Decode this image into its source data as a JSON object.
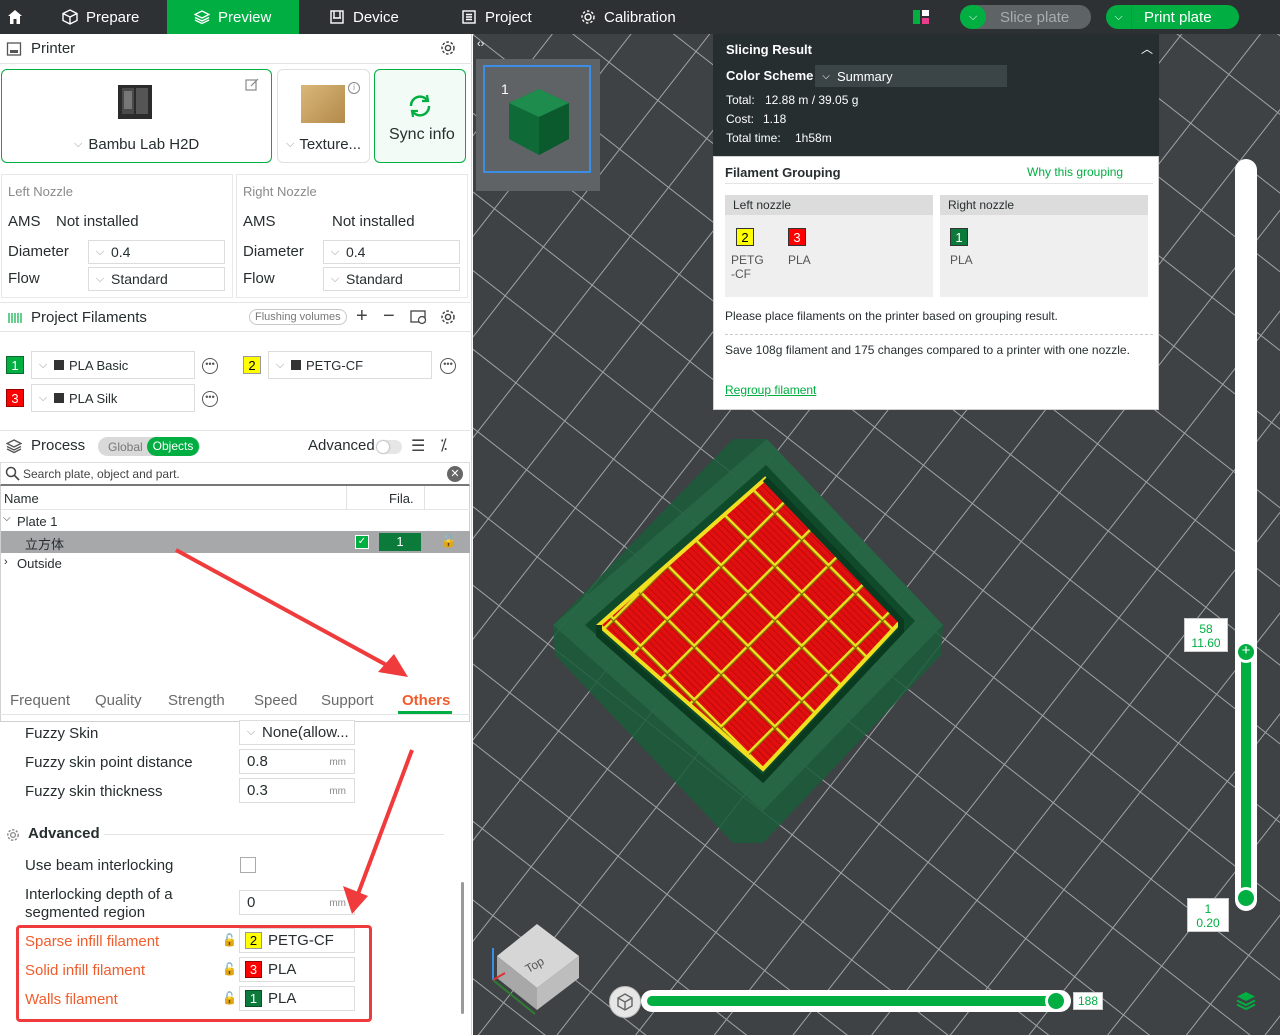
{
  "topbar": {
    "tabs": [
      {
        "label": "Prepare",
        "icon": "cube-icon"
      },
      {
        "label": "Preview",
        "icon": "layers-icon"
      },
      {
        "label": "Device",
        "icon": "printer-icon"
      },
      {
        "label": "Project",
        "icon": "project-icon"
      },
      {
        "label": "Calibration",
        "icon": "gear-icon"
      }
    ],
    "slice_label": "Slice plate",
    "print_label": "Print plate",
    "accent": "#00ae42",
    "bar_color": "#2e3133"
  },
  "printer": {
    "title": "Printer",
    "model": "Bambu Lab H2D",
    "plate": "Texture...",
    "sync_label": "Sync info",
    "left_nozzle": {
      "title": "Left Nozzle",
      "ams_label": "AMS",
      "ams_value": "Not installed",
      "diameter_label": "Diameter",
      "diameter": "0.4",
      "flow_label": "Flow",
      "flow": "Standard"
    },
    "right_nozzle": {
      "title": "Right Nozzle",
      "ams_label": "AMS",
      "ams_value": "Not installed",
      "diameter_label": "Diameter",
      "diameter": "0.4",
      "flow_label": "Flow",
      "flow": "Standard"
    }
  },
  "filaments": {
    "title": "Project Filaments",
    "flushing_label": "Flushing volumes",
    "items": [
      {
        "num": "1",
        "name": "PLA Basic",
        "color": "#00ae42"
      },
      {
        "num": "2",
        "name": "PETG-CF",
        "color": "#ffff00"
      },
      {
        "num": "3",
        "name": "PLA Silk",
        "color": "#ff0000"
      }
    ]
  },
  "process": {
    "title": "Process",
    "toggle_global": "Global",
    "toggle_objects": "Objects",
    "advanced_label": "Advanced",
    "search_placeholder": "Search plate, object and part.",
    "col_name": "Name",
    "col_fila": "Fila.",
    "tree": {
      "plate": "Plate 1",
      "object": "立方体",
      "object_fila": "1",
      "outside": "Outside"
    }
  },
  "settings": {
    "tabs": [
      "Frequent",
      "Quality",
      "Strength",
      "Speed",
      "Support",
      "Others"
    ],
    "active_tab": "Others",
    "fuzzy_skin_label": "Fuzzy Skin",
    "fuzzy_skin_value": "None(allow...",
    "fuzzy_point_label": "Fuzzy skin point distance",
    "fuzzy_point_value": "0.8",
    "fuzzy_thick_label": "Fuzzy skin thickness",
    "fuzzy_thick_value": "0.3",
    "unit_mm": "mm",
    "advanced_title": "Advanced",
    "beam_label": "Use beam interlocking",
    "depth_label": "Interlocking depth of a segmented region",
    "depth_value": "0",
    "sparse_label": "Sparse infill filament",
    "sparse_num": "2",
    "sparse_value": "PETG-CF",
    "solid_label": "Solid infill filament",
    "solid_num": "3",
    "solid_value": "PLA",
    "walls_label": "Walls filament",
    "walls_num": "1",
    "walls_value": "PLA"
  },
  "slicing": {
    "title": "Slicing Result",
    "scheme_label": "Color Scheme",
    "scheme_value": "Summary",
    "total_label": "Total:",
    "total_value": "12.88 m / 39.05 g",
    "cost_label": "Cost:",
    "cost_value": "1.18",
    "time_label": "Total time:",
    "time_value": "1h58m",
    "grouping_title": "Filament Grouping",
    "why_label": "Why this grouping",
    "left_nozzle_label": "Left nozzle",
    "right_nozzle_label": "Right nozzle",
    "left_items": [
      {
        "num": "2",
        "name": "PETG\n-CF",
        "color": "#ffff00"
      },
      {
        "num": "3",
        "name": "PLA",
        "color": "#ff0000"
      }
    ],
    "right_items": [
      {
        "num": "1",
        "name": "PLA",
        "color": "#00ae42"
      }
    ],
    "place_msg": "Please place filaments on the printer based on grouping result.",
    "save_msg": "Save 108g filament and 175 changes compared to a printer with one nozzle.",
    "regroup_label": "Regroup filament"
  },
  "plate_thumb": {
    "number": "1"
  },
  "layer_slider": {
    "top_layer": "58",
    "top_height": "11.60",
    "bottom_layer": "1",
    "bottom_height": "0.20"
  },
  "move_slider": {
    "value": "188"
  },
  "nav_cube": {
    "face": "Top"
  }
}
